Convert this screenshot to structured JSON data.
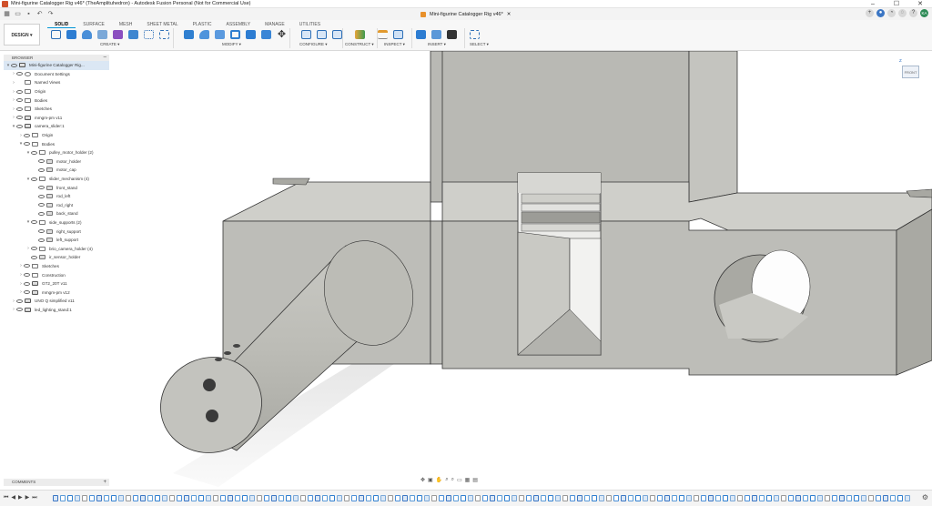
{
  "window": {
    "title": "Mini-figurine Catalogger Rig v46* (TheAmplituhedron) - Autodesk Fusion Personal (Not for Commercial Use)",
    "doc_tab": "Mini-figurine Catalogger Rig v46*",
    "controls": [
      "–",
      "☐",
      "✕"
    ]
  },
  "workspace": {
    "label": "DESIGN ▾"
  },
  "tabs": [
    "SOLID",
    "SURFACE",
    "MESH",
    "SHEET METAL",
    "PLASTIC",
    "ASSEMBLY",
    "MANAGE",
    "UTILITIES"
  ],
  "groups": [
    "CREATE ▾",
    "MODIFY ▾",
    "CONFIGURE ▾",
    "CONSTRUCT ▾",
    "INSPECT ▾",
    "INSERT ▾",
    "SELECT ▾"
  ],
  "browser": {
    "title": "BROWSER",
    "items": [
      {
        "label": "Mini-figurine Catalogger Rig...",
        "depth": 0
      },
      {
        "label": "Document Settings",
        "depth": 1
      },
      {
        "label": "Named Views",
        "depth": 1
      },
      {
        "label": "Origin",
        "depth": 1
      },
      {
        "label": "Bodies",
        "depth": 1
      },
      {
        "label": "Sketches",
        "depth": 1
      },
      {
        "label": "mmgm-pm v11",
        "depth": 1
      },
      {
        "label": "camera_slider:1",
        "depth": 1
      },
      {
        "label": "Origin",
        "depth": 2
      },
      {
        "label": "Bodies",
        "depth": 2
      },
      {
        "label": "pulley_motor_holder (2)",
        "depth": 3
      },
      {
        "label": "motor_holder",
        "depth": 4
      },
      {
        "label": "motor_cap",
        "depth": 4
      },
      {
        "label": "slider_mechanism (4)",
        "depth": 3
      },
      {
        "label": "front_stand",
        "depth": 4
      },
      {
        "label": "rod_left",
        "depth": 4
      },
      {
        "label": "rod_right",
        "depth": 4
      },
      {
        "label": "back_stand",
        "depth": 4
      },
      {
        "label": "side_supports (2)",
        "depth": 3
      },
      {
        "label": "right_support",
        "depth": 4
      },
      {
        "label": "left_support",
        "depth": 4
      },
      {
        "label": "brio_camera_holder (4)",
        "depth": 3
      },
      {
        "label": "ir_sensor_holder",
        "depth": 4
      },
      {
        "label": "Sketches",
        "depth": 2
      },
      {
        "label": "Construction",
        "depth": 2
      },
      {
        "label": "GT2_20T v11",
        "depth": 2
      },
      {
        "label": "mmgm-pm v12",
        "depth": 2
      },
      {
        "label": "UNO Q simplified v11",
        "depth": 1
      },
      {
        "label": "led_lighting_stand:1",
        "depth": 1
      }
    ]
  },
  "viewcube": {
    "face": "FRONT",
    "axis": "Z"
  },
  "comments": {
    "label": "COMMENTS"
  },
  "colors": {
    "accent": "#0696d7",
    "model_face": "#bdbdb8",
    "model_top": "#cfcfca",
    "model_dark": "#a9a9a3"
  }
}
